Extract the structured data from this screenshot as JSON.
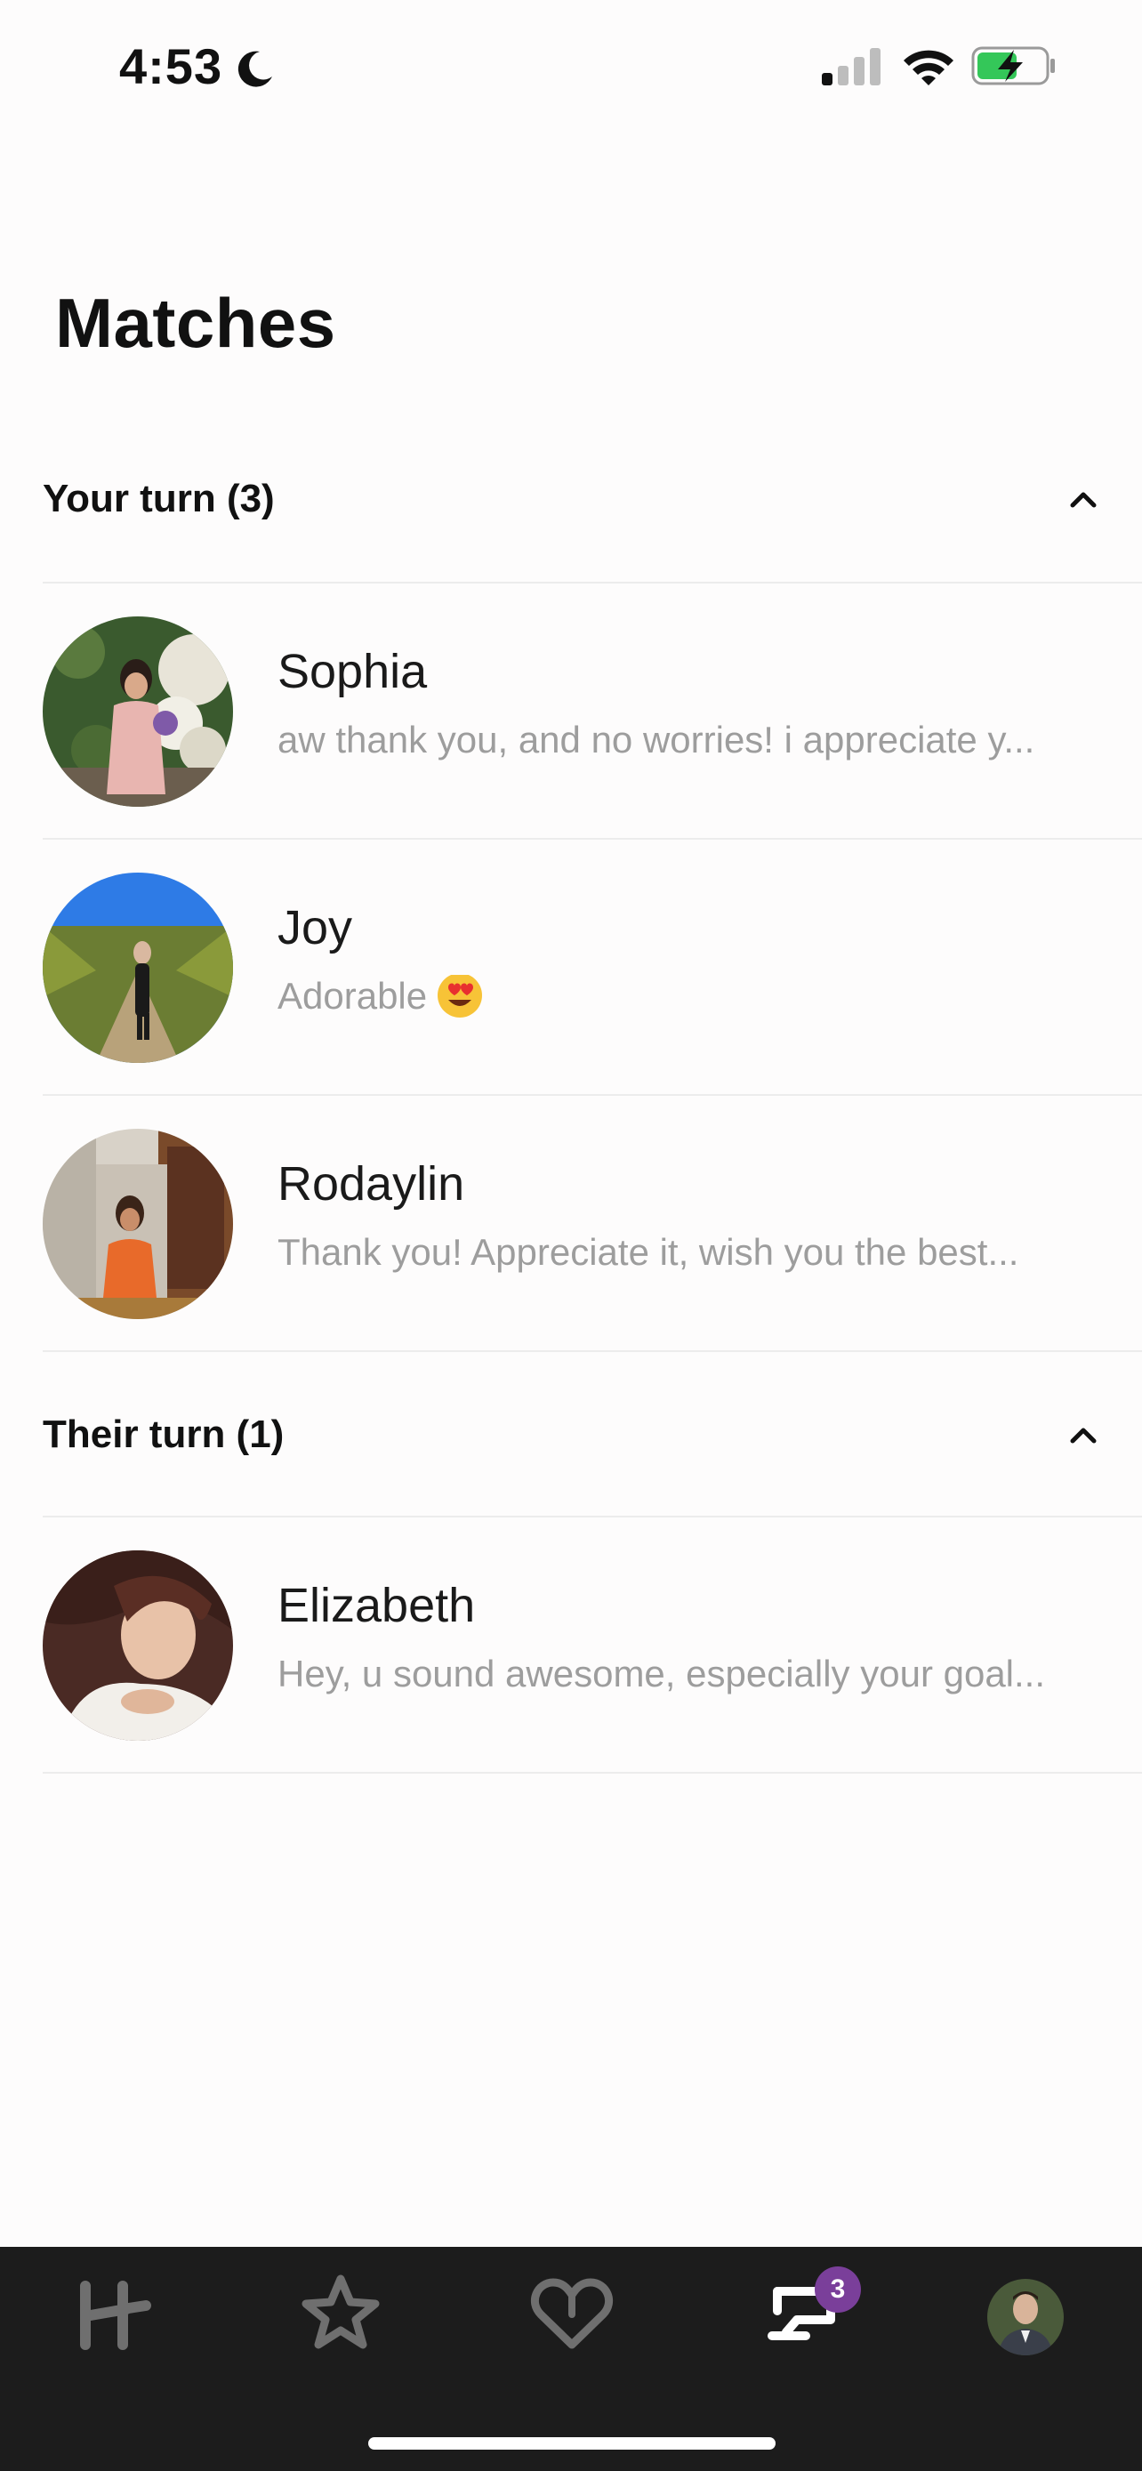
{
  "status_bar": {
    "time": "4:53",
    "icons": [
      "moon-icon",
      "signal-icon",
      "wifi-icon",
      "battery-charging-icon"
    ]
  },
  "title": "Matches",
  "sections": [
    {
      "label": "Your turn (3)",
      "matches": [
        {
          "name": "Sophia",
          "preview": "aw thank you, and no worries! i appreciate y..."
        },
        {
          "name": "Joy",
          "preview": "Adorable",
          "emoji": "heart-eyes-emoji"
        },
        {
          "name": "Rodaylin",
          "preview": "Thank you! Appreciate it, wish you the best..."
        }
      ]
    },
    {
      "label": "Their turn (1)",
      "matches": [
        {
          "name": "Elizabeth",
          "preview": "Hey, u sound awesome, especially your goal..."
        }
      ]
    }
  ],
  "tab_bar": {
    "tabs": [
      "home-logo-icon",
      "star-icon",
      "heart-icon",
      "chat-icon",
      "profile-avatar"
    ],
    "chat_badge": "3"
  },
  "colors": {
    "background": "#fdfcfc",
    "preview_text": "#9d9d9d",
    "tab_bar": "#1c1c1c",
    "badge": "#7a3f9a",
    "battery_fill": "#34c759"
  }
}
